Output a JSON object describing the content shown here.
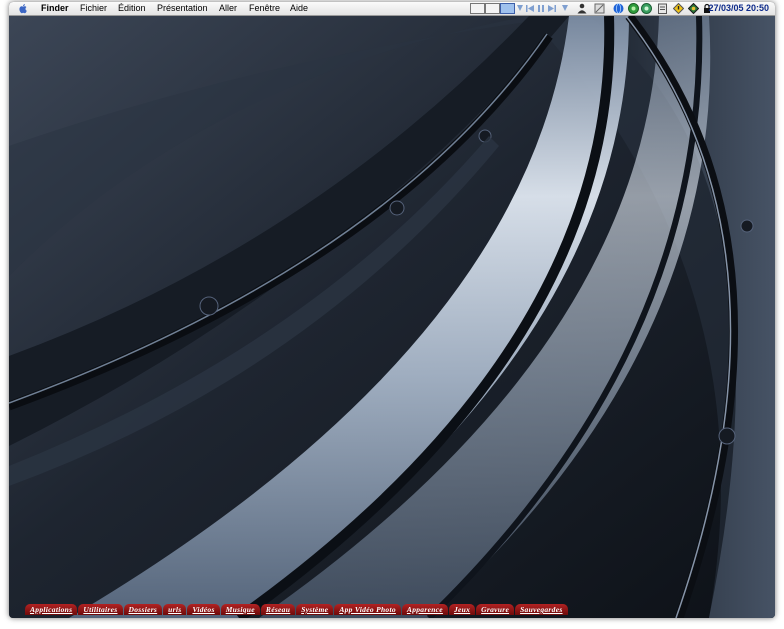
{
  "menubar": {
    "apple_icon": "apple-logo-icon",
    "app_name": "Finder",
    "menus": [
      "Fichier",
      "Édition",
      "Présentation",
      "Aller",
      "Fenêtre",
      "Aide"
    ],
    "clock": "27/03/05 20:50"
  },
  "dock_tabs": [
    "Applications",
    "Utilitaires",
    "Dossiers",
    "urls",
    "Vidéos",
    "Musique",
    "Réseau",
    "Système",
    "App Vidéo Photo",
    "Apparence",
    "Jeux",
    "Gravure",
    "Sauvegardes"
  ],
  "colors": {
    "tab_red": "#9b1515",
    "clock_blue": "#0d2a8a",
    "wallpaper_dark": "#1b222c"
  }
}
